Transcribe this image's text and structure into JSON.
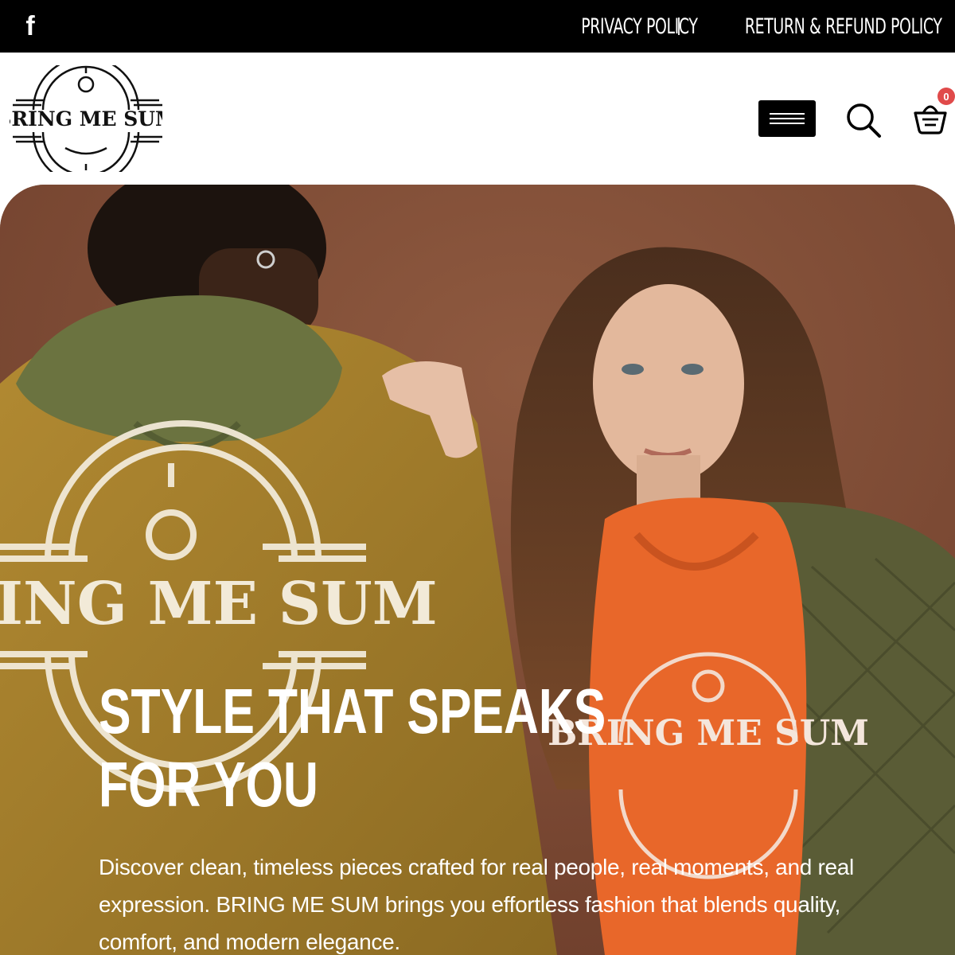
{
  "topbar": {
    "social_icon": "facebook-icon",
    "links": [
      "PRIVACY POLICY",
      "RETURN & REFUND POLICY"
    ]
  },
  "header": {
    "logo_text": "BRING ME SUM",
    "menu_icon": "hamburger-icon",
    "search_icon": "search-icon",
    "cart_icon": "shopping-basket-icon",
    "cart_count": "0"
  },
  "hero": {
    "title_line1": "STYLE THAT SPEAKS",
    "title_line2": "FOR YOU",
    "description": "Discover clean, timeless pieces crafted for real people, real moments, and real expression.  BRING ME SUM brings you effortless fashion that blends quality, comfort, and modern elegance.",
    "jacket_print": "BRING ME SUM",
    "hoodie_print": "BRING ME SUM"
  },
  "colors": {
    "topbar_bg": "#000000",
    "hero_bg": "#7d4a33",
    "badge": "#e04a4a",
    "jacket": "#a8802a",
    "hoodie": "#e8672a",
    "green_hood": "#6b7340"
  }
}
